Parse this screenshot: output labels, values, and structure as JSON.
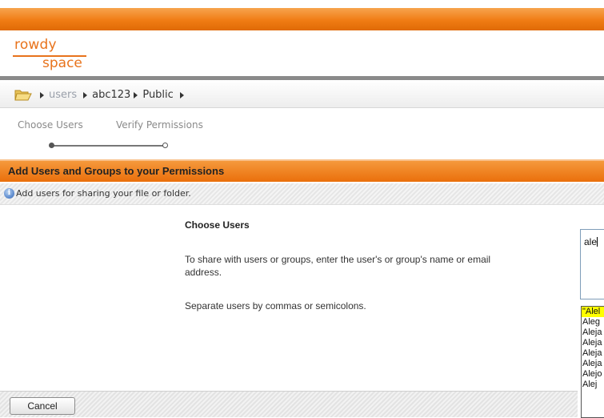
{
  "logo": {
    "line1": "rowdy",
    "line2": "space"
  },
  "breadcrumb": {
    "icon": "folder-icon",
    "items": [
      "users",
      "abc123",
      "Public"
    ]
  },
  "steps": [
    {
      "label": "Choose Users",
      "state": "current"
    },
    {
      "label": "Verify Permissions",
      "state": "pending"
    }
  ],
  "section": {
    "title": "Add Users and Groups to your Permissions"
  },
  "info": {
    "icon": "info-icon",
    "text": "Add users for sharing your file or folder."
  },
  "main": {
    "title": "Choose Users",
    "para1": "To share with users or groups, enter the user's or group's name or email address.",
    "para2": "Separate users by commas or semicolons."
  },
  "user_input": {
    "value": "ale"
  },
  "suggestions": [
    "\"Alel",
    "Aleg",
    "Aleja",
    "Aleja",
    "Aleja",
    "Aleja",
    "Alejo",
    "Alej"
  ],
  "footer": {
    "cancel_label": "Cancel"
  },
  "colors": {
    "accent": "#f07c14",
    "highlight": "#ffff00"
  }
}
